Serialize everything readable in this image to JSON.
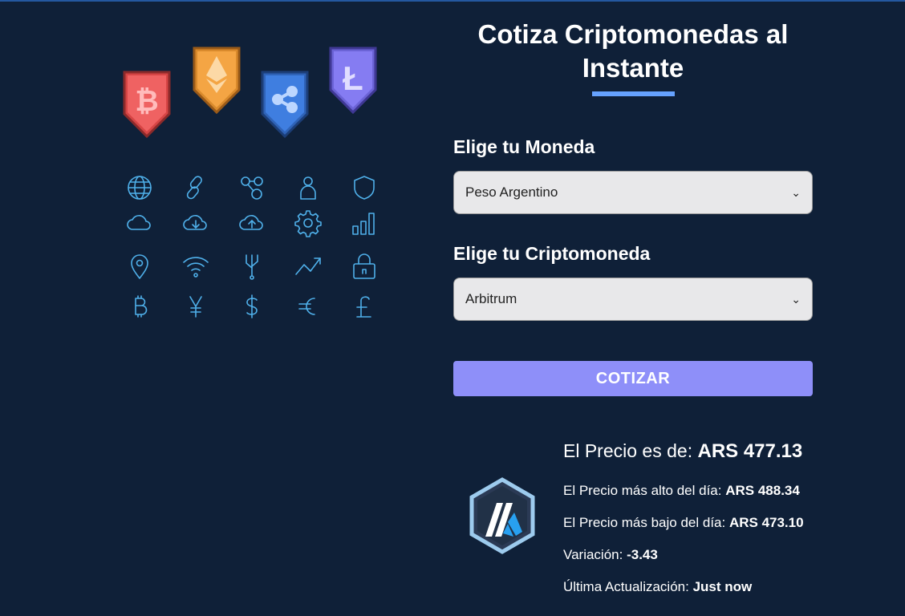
{
  "title": "Cotiza Criptomonedas al Instante",
  "form": {
    "currency_label": "Elige tu Moneda",
    "currency_value": "Peso Argentino",
    "crypto_label": "Elige tu Criptomoneda",
    "crypto_value": "Arbitrum",
    "submit_label": "COTIZAR"
  },
  "result": {
    "price_label": "El Precio es de:",
    "price_value": "ARS 477.13",
    "high_label": "El Precio más alto del día:",
    "high_value": "ARS 488.34",
    "low_label": "El Precio más bajo del día:",
    "low_value": "ARS 473.10",
    "change_label": "Variación:",
    "change_value": "-3.43",
    "updated_label": "Última Actualización:",
    "updated_value": "Just now"
  },
  "icons": {
    "coins": [
      "bitcoin-badge-icon",
      "ethereum-badge-icon",
      "ripple-badge-icon",
      "litecoin-badge-icon"
    ],
    "grid": [
      "globe-icon",
      "chain-link-icon",
      "network-nodes-icon",
      "user-icon",
      "shield-icon",
      "cloud-icon",
      "cloud-download-icon",
      "cloud-upload-icon",
      "gear-icon",
      "bar-chart-icon",
      "location-pin-icon",
      "wifi-icon",
      "circuit-icon",
      "trend-up-icon",
      "lock-icon",
      "bitcoin-symbol-icon",
      "yen-symbol-icon",
      "dollar-symbol-icon",
      "euro-symbol-icon",
      "pound-symbol-icon"
    ],
    "crypto_logo": "arbitrum-logo-icon"
  },
  "colors": {
    "background": "#0f2038",
    "accent": "#66a2fe",
    "button": "#8e8ff9",
    "icon_stroke": "#4fb0ea"
  }
}
